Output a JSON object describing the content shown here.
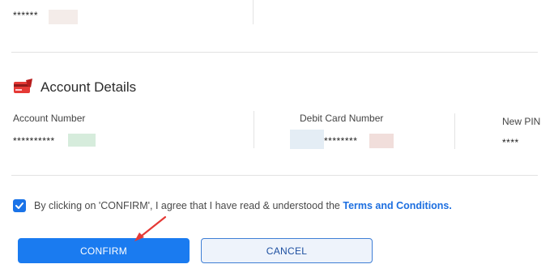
{
  "top": {
    "masked_value": "******"
  },
  "account_details": {
    "title": "Account Details",
    "icon": "card-icon",
    "account_number": {
      "label": "Account Number",
      "value": "**********"
    },
    "debit_card_number": {
      "label": "Debit Card Number",
      "value": "********"
    },
    "new_pin": {
      "label": "New PIN",
      "value": "****"
    }
  },
  "agreement": {
    "checked": true,
    "text": "By clicking on 'CONFIRM', I agree that I have read & understood the",
    "link": "Terms and Conditions."
  },
  "buttons": {
    "confirm": "CONFIRM",
    "cancel": "CANCEL"
  },
  "colors": {
    "primary": "#1a7bf0",
    "link": "#1d6fe0",
    "annotation": "#e53935"
  }
}
